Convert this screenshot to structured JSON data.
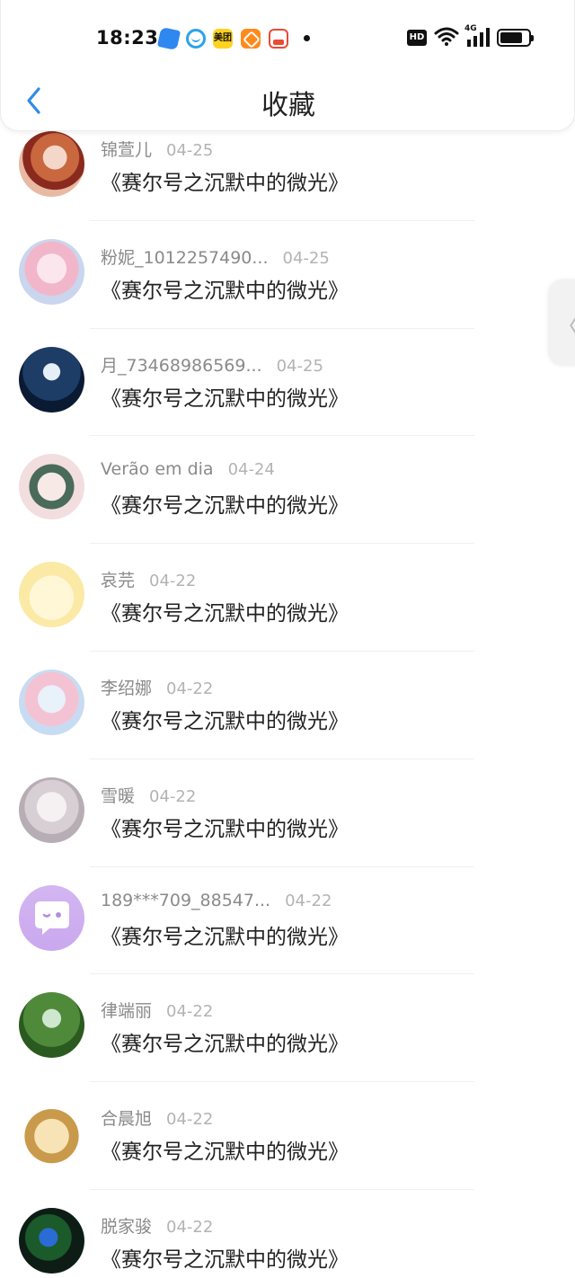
{
  "status_bar": {
    "time": "18:23",
    "app_icons": [
      "blue-leaf-app-icon",
      "smile-app-icon",
      "meituan-app-icon",
      "orange-app-icon",
      "red-app-icon"
    ],
    "meituan_label": "美团",
    "hd_label": "HD",
    "network": "4G",
    "battery_percent": 80
  },
  "header": {
    "title": "收藏",
    "back_icon": "chevron-left-icon"
  },
  "colors": {
    "accent": "#2f8bea",
    "name": "#8a8a8a",
    "date": "#b3b3b3",
    "title": "#222222"
  },
  "items": [
    {
      "name": "锦萱儿",
      "date": "04-25",
      "title": "《赛尔号之沉默中的微光》"
    },
    {
      "name": "粉妮_1012257490...",
      "date": "04-25",
      "title": "《赛尔号之沉默中的微光》"
    },
    {
      "name": "月_73468986569...",
      "date": "04-25",
      "title": "《赛尔号之沉默中的微光》"
    },
    {
      "name": "Verão em dia",
      "date": "04-24",
      "title": "《赛尔号之沉默中的微光》"
    },
    {
      "name": "哀芫",
      "date": "04-22",
      "title": "《赛尔号之沉默中的微光》"
    },
    {
      "name": "李绍娜",
      "date": "04-22",
      "title": "《赛尔号之沉默中的微光》"
    },
    {
      "name": "雪暖",
      "date": "04-22",
      "title": "《赛尔号之沉默中的微光》"
    },
    {
      "name": "189***709_88547...",
      "date": "04-22",
      "title": "《赛尔号之沉默中的微光》"
    },
    {
      "name": "律端丽",
      "date": "04-22",
      "title": "《赛尔号之沉默中的微光》"
    },
    {
      "name": "合晨旭",
      "date": "04-22",
      "title": "《赛尔号之沉默中的微光》"
    },
    {
      "name": "脱家骏",
      "date": "04-22",
      "title": "《赛尔号之沉默中的微光》"
    }
  ]
}
